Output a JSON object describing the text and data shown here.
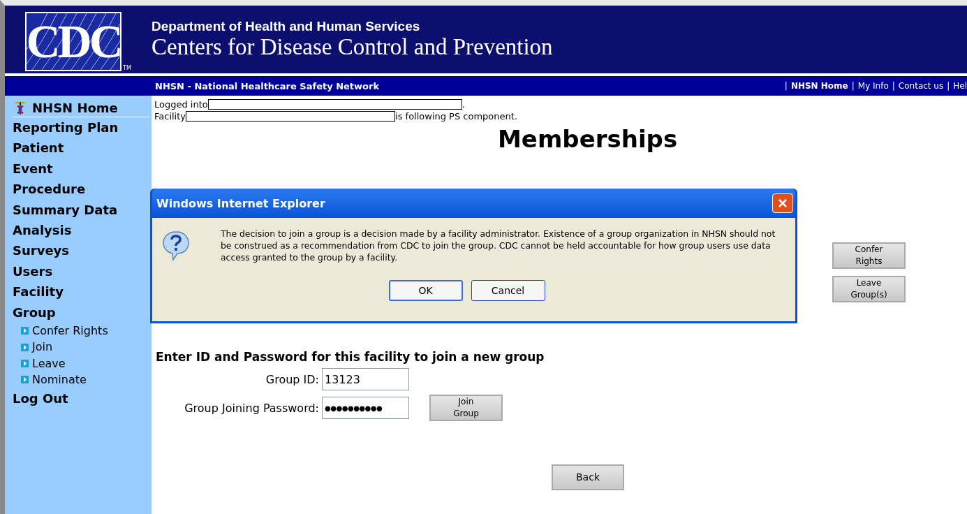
{
  "header": {
    "logo": "CDC",
    "trademark": "TM",
    "department": "Department of Health and Human Services",
    "agency": "Centers for Disease Control and Prevention"
  },
  "navbar": {
    "title": "NHSN - National Healthcare Safety Network",
    "separator": "|",
    "links": [
      {
        "label": "NHSN Home",
        "selected": true
      },
      {
        "label": "My Info",
        "selected": false
      },
      {
        "label": "Contact us",
        "selected": false
      },
      {
        "label": "Hel",
        "selected": false
      }
    ]
  },
  "sidebar": {
    "home": "NHSN Home",
    "items": [
      {
        "label": "Reporting Plan"
      },
      {
        "label": "Patient"
      },
      {
        "label": "Event"
      },
      {
        "label": "Procedure"
      },
      {
        "label": "Summary Data"
      },
      {
        "label": "Analysis"
      },
      {
        "label": "Surveys"
      },
      {
        "label": "Users"
      },
      {
        "label": "Facility"
      },
      {
        "label": "Group",
        "children": [
          {
            "label": "Confer Rights"
          },
          {
            "label": "Join"
          },
          {
            "label": "Leave"
          },
          {
            "label": "Nominate"
          }
        ]
      },
      {
        "label": "Log Out"
      }
    ]
  },
  "status": {
    "logged_into": "Logged into",
    "logged_end": ".",
    "facility": "Facility",
    "following": "is following PS component."
  },
  "page_title": "Memberships",
  "side_buttons": [
    "Confer Rights",
    "Leave Group(s)"
  ],
  "join_form": {
    "heading": "Enter ID and Password for this facility to join a new group",
    "group_id_label": "Group ID:",
    "group_id": "13123",
    "password_label": "Group Joining Password:",
    "password": "●●●●●●●●●●",
    "join_button": "Join Group"
  },
  "back_button": "Back",
  "dialog": {
    "title": "Windows Internet Explorer",
    "message": "The decision to join a group is a decision made by a facility administrator.  Existence of a group organization in NHSN should not be construed as a recommendation from CDC to join the group.  CDC cannot be held accountable for how group users use data access granted to the group by a facility.",
    "buttons": [
      {
        "label": "OK",
        "selected": true
      },
      {
        "label": "Cancel",
        "selected": false
      }
    ]
  }
}
